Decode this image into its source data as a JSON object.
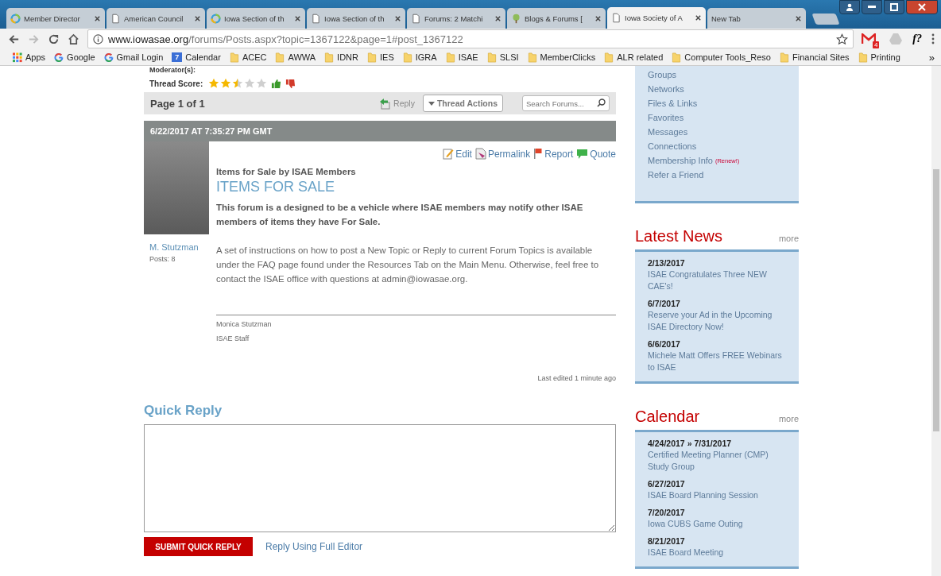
{
  "browser": {
    "tabs": [
      {
        "title": "Member Director",
        "kind": "ring",
        "selected": false
      },
      {
        "title": "American Council",
        "kind": "page",
        "selected": false
      },
      {
        "title": "Iowa Section of th",
        "kind": "ring",
        "selected": false
      },
      {
        "title": "Iowa Section of th",
        "kind": "page",
        "selected": false
      },
      {
        "title": "Forums: 2 Matchi",
        "kind": "page",
        "selected": false
      },
      {
        "title": "Blogs & Forums [",
        "kind": "tree",
        "selected": false
      },
      {
        "title": "Iowa Society of A",
        "kind": "page",
        "selected": true
      },
      {
        "title": "New Tab",
        "kind": "blank",
        "selected": false
      }
    ],
    "address": {
      "host": "www.iowasae.org",
      "path": "/forums/Posts.aspx?topic=1367122&page=1#post_1367122"
    },
    "extensions": [
      {
        "kind": "gmail",
        "badge": "4"
      },
      {
        "kind": "drive"
      },
      {
        "kind": "text",
        "label": "f?"
      }
    ],
    "bookmarks": [
      {
        "label": "Apps",
        "kind": "apps"
      },
      {
        "label": "Google",
        "kind": "google"
      },
      {
        "label": "Gmail Login",
        "kind": "google"
      },
      {
        "label": "Calendar",
        "kind": "calendar",
        "icon_text": "7"
      },
      {
        "label": "ACEC",
        "kind": "folder"
      },
      {
        "label": "AWWA",
        "kind": "folder"
      },
      {
        "label": "IDNR",
        "kind": "folder"
      },
      {
        "label": "IES",
        "kind": "folder"
      },
      {
        "label": "IGRA",
        "kind": "folder"
      },
      {
        "label": "ISAE",
        "kind": "folder"
      },
      {
        "label": "SLSI",
        "kind": "folder"
      },
      {
        "label": "MemberClicks",
        "kind": "folder"
      },
      {
        "label": "ALR related",
        "kind": "folder"
      },
      {
        "label": "Computer Tools_Reso",
        "kind": "folder"
      },
      {
        "label": "Financial Sites",
        "kind": "folder"
      },
      {
        "label": "Printing",
        "kind": "folder"
      }
    ],
    "bookmarks_overflow": "»"
  },
  "thread": {
    "moderators_label": "Moderator(s):",
    "score_label": "Thread Score:",
    "stars": 2.5,
    "pager": "Page 1 of 1",
    "reply": "Reply",
    "thread_actions": "Thread Actions",
    "search_placeholder": "Search Forums..."
  },
  "post": {
    "timestamp": "6/22/2017 AT 7:35:27 PM GMT",
    "author": "M. Stutzman",
    "posts": "Posts: 8",
    "actions": [
      {
        "label": "Edit",
        "kind": "edit"
      },
      {
        "label": "Permalink",
        "kind": "permalink"
      },
      {
        "label": "Report",
        "kind": "report"
      },
      {
        "label": "Quote",
        "kind": "quote"
      }
    ],
    "subtitle": "Items for Sale by ISAE Members",
    "title": "ITEMS FOR SALE",
    "lead": "This forum is a designed to be a vehicle where ISAE members may notify other ISAE members of items they have For Sale.",
    "body": "A set of instructions on how to post a New Topic or Reply to current Forum Topics is available under the FAQ page found under the Resources Tab on the Main Menu.  Otherwise, feel free to contact the ISAE office with questions at admin@iowasae.org.",
    "signature": [
      "Monica Stutzman",
      "ISAE Staff"
    ],
    "last_edited": "Last edited 1 minute ago"
  },
  "quick_reply": {
    "title": "Quick Reply",
    "submit": "SUBMIT QUICK REPLY",
    "full_editor": "Reply Using Full Editor"
  },
  "sidebar": {
    "menu": [
      {
        "label": "Groups"
      },
      {
        "label": "Networks"
      },
      {
        "label": "Files & Links"
      },
      {
        "label": "Favorites"
      },
      {
        "label": "Messages"
      },
      {
        "label": "Connections"
      },
      {
        "label": "Membership Info",
        "note": "(Renew!)"
      },
      {
        "label": "Refer a Friend"
      }
    ],
    "news": {
      "title": "Latest News",
      "more": "more",
      "items": [
        {
          "date": "2/13/2017",
          "text": "ISAE Congratulates Three NEW CAE's!"
        },
        {
          "date": "6/7/2017",
          "text": "Reserve your Ad in the Upcoming ISAE Directory Now!"
        },
        {
          "date": "6/6/2017",
          "text": "Michele Matt Offers FREE Webinars to ISAE"
        }
      ]
    },
    "calendar": {
      "title": "Calendar",
      "more": "more",
      "items": [
        {
          "date": "4/24/2017 » 7/31/2017",
          "text": "Certified Meeting Planner (CMP) Study Group"
        },
        {
          "date": "6/27/2017",
          "text": "ISAE Board Planning Session"
        },
        {
          "date": "7/20/2017",
          "text": "Iowa CUBS Game Outing"
        },
        {
          "date": "8/21/2017",
          "text": "ISAE Board Meeting"
        }
      ]
    }
  }
}
